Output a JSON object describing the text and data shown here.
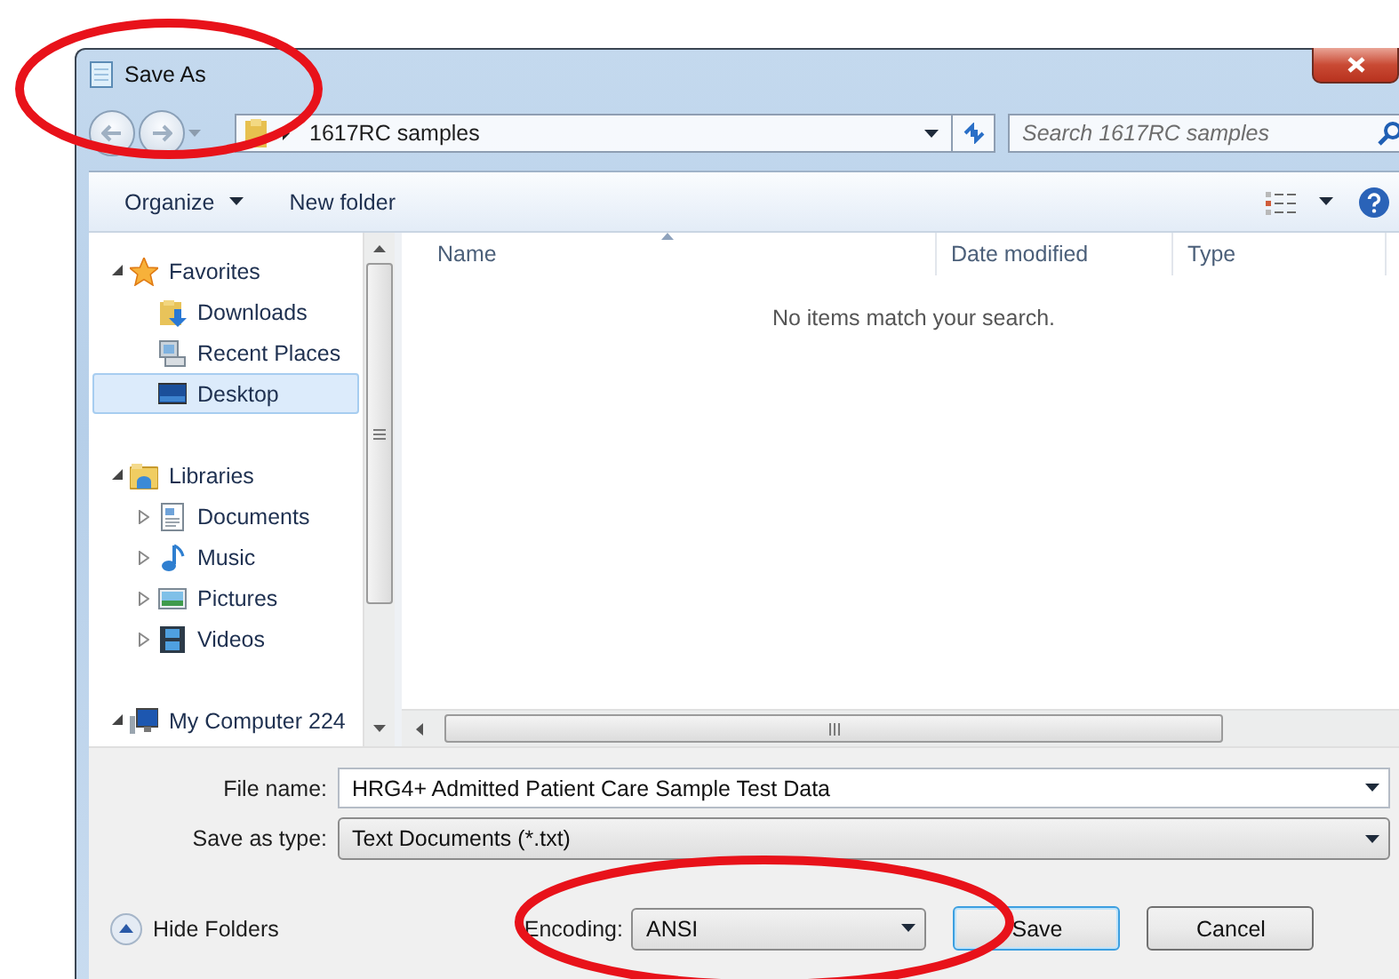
{
  "window": {
    "title": "Save As"
  },
  "address_bar": {
    "path": "1617RC samples"
  },
  "search": {
    "placeholder": "Search 1617RC samples"
  },
  "toolbar": {
    "organize": "Organize",
    "new_folder": "New folder"
  },
  "navigation": [
    {
      "label": "Favorites",
      "kind": "star",
      "expanded": true,
      "children": [
        {
          "label": "Downloads",
          "kind": "downloads",
          "selected": false
        },
        {
          "label": "Recent Places",
          "kind": "recent",
          "selected": false
        },
        {
          "label": "Desktop",
          "kind": "desktop",
          "selected": true
        }
      ]
    },
    {
      "label": "Libraries",
      "kind": "libraries",
      "expanded": true,
      "children": [
        {
          "label": "Documents",
          "kind": "documents",
          "selected": false,
          "expanded": false
        },
        {
          "label": "Music",
          "kind": "music",
          "selected": false,
          "expanded": false
        },
        {
          "label": "Pictures",
          "kind": "pictures",
          "selected": false,
          "expanded": false
        },
        {
          "label": "Videos",
          "kind": "videos",
          "selected": false,
          "expanded": false
        }
      ]
    },
    {
      "label": "My Computer 224",
      "kind": "computer",
      "expanded": true
    }
  ],
  "file_list": {
    "columns": [
      {
        "label": "Name",
        "sorted": true
      },
      {
        "label": "Date modified",
        "sorted": false
      },
      {
        "label": "Type",
        "sorted": false
      }
    ],
    "empty_message": "No items match your search."
  },
  "form": {
    "file_name": {
      "label": "File name:",
      "value": "HRG4+ Admitted Patient Care Sample Test Data"
    },
    "save_as_type": {
      "label": "Save as type:",
      "value": "Text Documents (*.txt)"
    },
    "hide_folders": "Hide Folders",
    "encoding": {
      "label": "Encoding:",
      "value": "ANSI"
    },
    "buttons": [
      {
        "label": "Save",
        "default": true
      },
      {
        "label": "Cancel",
        "default": false
      }
    ]
  },
  "annotations": [
    {
      "kind": "ellipse"
    },
    {
      "kind": "ellipse"
    }
  ]
}
